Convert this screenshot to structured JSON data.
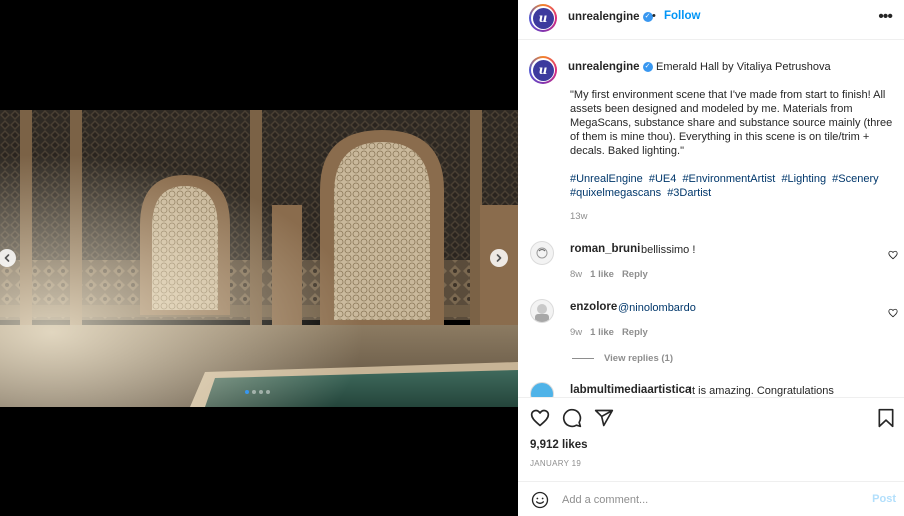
{
  "header": {
    "username": "unrealengine",
    "separator": "•",
    "follow_label": "Follow",
    "more_label": "•••",
    "avatar_letter": "u"
  },
  "caption": {
    "username": "unrealengine",
    "title": "Emerald Hall by Vitaliya Petrushova",
    "text": "\"My first environment scene that I've made from start to finish! All assets been designed and modeled by me. Materials from MegaScans, substance share and substance source mainly (three of them is mine thou). Everything in this scene is on tile/trim + decals. Baked lighting.\"",
    "hashtags": [
      "#UnrealEngine",
      "#UE4",
      "#EnvironmentArtist",
      "#Lighting",
      "#Scenery",
      "#quixelmegascans",
      "#3Dartist"
    ],
    "time": "13w"
  },
  "comments": [
    {
      "username": "roman_bruni",
      "text": "bellissimo !",
      "time": "8w",
      "likes": "1 like",
      "reply": "Reply"
    },
    {
      "username": "enzolore",
      "text": "@ninolombardo",
      "time": "9w",
      "likes": "1 like",
      "reply": "Reply",
      "view_replies": "View replies (1)"
    },
    {
      "username": "labmultimediaartistica",
      "text": "It is amazing. Congratulations"
    }
  ],
  "footer": {
    "likes": "9,912 likes",
    "date": "JANUARY 19",
    "comment_placeholder": "Add a comment...",
    "post_label": "Post"
  },
  "carousel": {
    "slide_count": 4,
    "active_slide": 1,
    "accent_color": "#3897f0"
  },
  "icons": {
    "actions": [
      "heart-icon",
      "comment-icon",
      "share-icon",
      "bookmark-icon"
    ],
    "emoji": "smile-icon"
  }
}
